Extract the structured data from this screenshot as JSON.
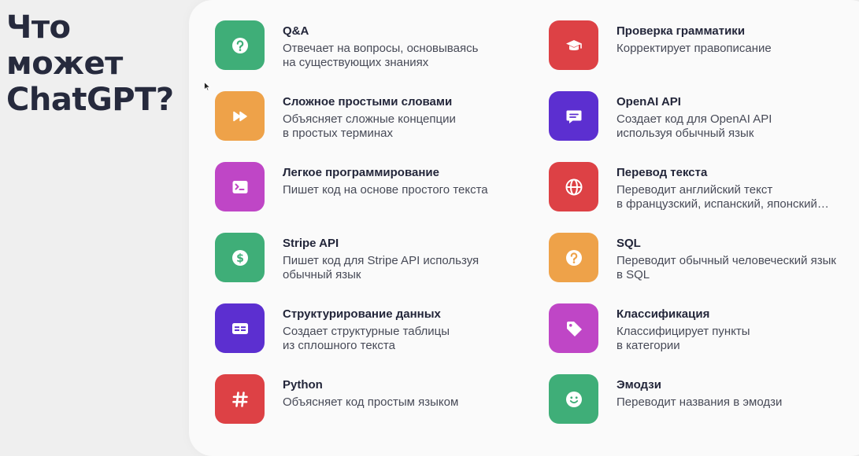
{
  "title_lines": [
    "Что",
    "может",
    "ChatGPT?"
  ],
  "features": [
    {
      "title": "Q&A",
      "desc": [
        "Отвечает на вопросы, основываясь",
        "на существующих знаниях"
      ],
      "icon": "question-icon",
      "color": "#3fae78"
    },
    {
      "title": "Сложное простыми словами",
      "desc": [
        "Объясняет сложные концепции",
        "в простых терминах"
      ],
      "icon": "fast-forward-icon",
      "color": "#eea249"
    },
    {
      "title": "Легкое программирование",
      "desc": [
        "Пишет код на основе простого текста"
      ],
      "icon": "terminal-icon",
      "color": "#bf46c6"
    },
    {
      "title": "Stripe API",
      "desc": [
        "Пишет код для Stripe API используя",
        "обычный язык"
      ],
      "icon": "dollar-icon",
      "color": "#3fae78"
    },
    {
      "title": "Структурирование данных",
      "desc": [
        "Создает структурные таблицы",
        "из сплошного текста"
      ],
      "icon": "table-icon",
      "color": "#5c2fd0"
    },
    {
      "title": "Python",
      "desc": [
        "Объясняет код простым языком"
      ],
      "icon": "hashtag-icon",
      "color": "#dd4145"
    },
    {
      "title": "Проверка грамматики",
      "desc": [
        "Корректирует правописание"
      ],
      "icon": "graduation-cap-icon",
      "color": "#dd4145"
    },
    {
      "title": "OpenAI API",
      "desc": [
        "Создает код для OpenAI API",
        "используя обычный язык"
      ],
      "icon": "chat-bubble-icon",
      "color": "#5c2fd0"
    },
    {
      "title": "Перевод текста",
      "desc": [
        "Переводит английский текст",
        "в французский, испанский, японский…"
      ],
      "icon": "globe-icon",
      "color": "#dd4145"
    },
    {
      "title": "SQL",
      "desc": [
        "Переводит обычный человеческий язык",
        "в SQL"
      ],
      "icon": "question-icon",
      "color": "#eea249"
    },
    {
      "title": "Классификация",
      "desc": [
        "Классифицирует пункты",
        "в категории"
      ],
      "icon": "tag-icon",
      "color": "#bf46c6"
    },
    {
      "title": "Эмодзи",
      "desc": [
        "Переводит названия в эмодзи"
      ],
      "icon": "smiley-icon",
      "color": "#3fae78"
    }
  ]
}
